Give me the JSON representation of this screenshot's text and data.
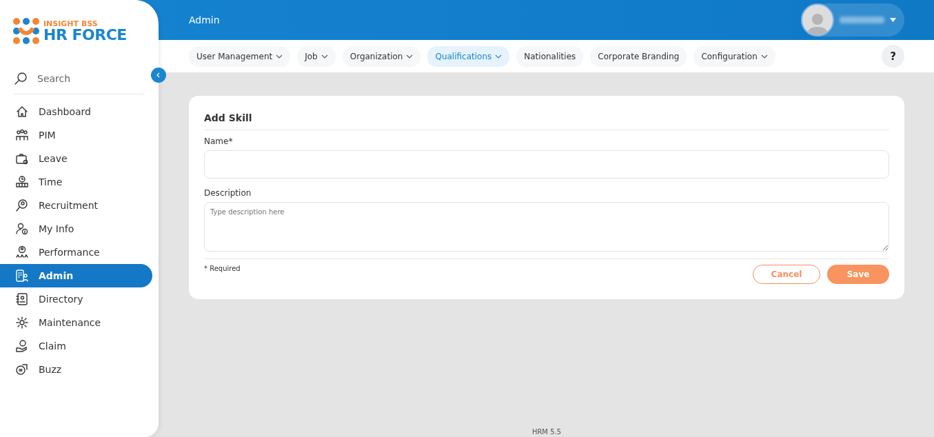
{
  "brand": {
    "tagline": "INSIGHT BSS",
    "name": "HR FORCE"
  },
  "sidebar": {
    "search": {
      "placeholder": "Search"
    },
    "items": [
      {
        "label": "Dashboard",
        "selected": false
      },
      {
        "label": "PIM",
        "selected": false
      },
      {
        "label": "Leave",
        "selected": false
      },
      {
        "label": "Time",
        "selected": false
      },
      {
        "label": "Recruitment",
        "selected": false
      },
      {
        "label": "My Info",
        "selected": false
      },
      {
        "label": "Performance",
        "selected": false
      },
      {
        "label": "Admin",
        "selected": true
      },
      {
        "label": "Directory",
        "selected": false
      },
      {
        "label": "Maintenance",
        "selected": false
      },
      {
        "label": "Claim",
        "selected": false
      },
      {
        "label": "Buzz",
        "selected": false
      }
    ]
  },
  "header": {
    "title": "Admin"
  },
  "nav": [
    {
      "label": "User Management",
      "dropdown": true,
      "selected": false
    },
    {
      "label": "Job",
      "dropdown": true,
      "selected": false
    },
    {
      "label": "Organization",
      "dropdown": true,
      "selected": false
    },
    {
      "label": "Qualifications",
      "dropdown": true,
      "selected": true
    },
    {
      "label": "Nationalities",
      "dropdown": false,
      "selected": false
    },
    {
      "label": "Corporate Branding",
      "dropdown": false,
      "selected": false
    },
    {
      "label": "Configuration",
      "dropdown": true,
      "selected": false
    }
  ],
  "help": "?",
  "form": {
    "title": "Add Skill",
    "fields": [
      {
        "label": "Name*",
        "kind": "input"
      },
      {
        "label": "Description",
        "kind": "textarea",
        "placeholder": "Type description here"
      }
    ],
    "required_note": "* Required",
    "buttons": [
      {
        "label": "Cancel",
        "kind": "outline"
      },
      {
        "label": "Save",
        "kind": "filled"
      }
    ]
  },
  "footer": "HRM 5.5"
}
